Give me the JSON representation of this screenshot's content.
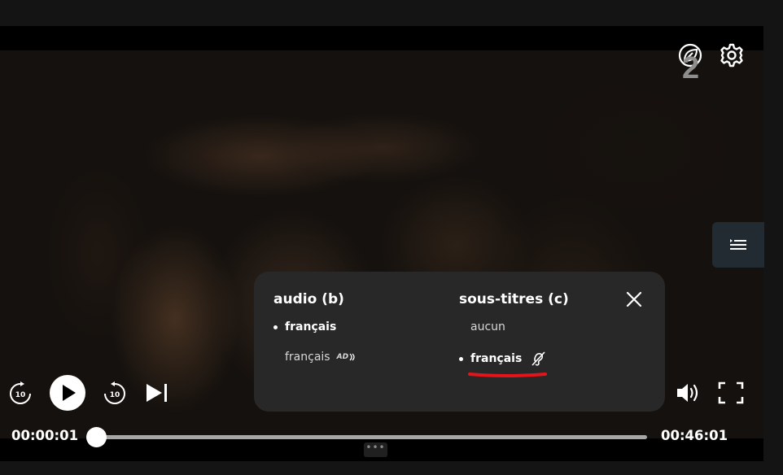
{
  "panel": {
    "audio": {
      "title": "audio (b)",
      "options": [
        {
          "label": "français",
          "selected": true
        },
        {
          "label": "français",
          "selected": false,
          "badge": "AD"
        }
      ]
    },
    "subtitles": {
      "title": "sous-titres (c)",
      "options": [
        {
          "label": "aucun",
          "selected": false
        },
        {
          "label": "français",
          "selected": true,
          "icon": "hearing-impaired-icon"
        }
      ]
    }
  },
  "player": {
    "current_time": "00:00:01",
    "total_time": "00:46:01",
    "progress": 0.0,
    "channel_logo": "2",
    "skip_seconds": "10"
  },
  "icons": [
    "eco-leaf-icon",
    "gear-icon",
    "chapters-list-icon",
    "close-icon",
    "replay-10-icon",
    "play-icon",
    "forward-10-icon",
    "skip-next-icon",
    "volume-icon",
    "fullscreen-icon",
    "more-dots-icon"
  ],
  "colors": {
    "accent_underline": "#e3141a",
    "panel_bg": "#282828",
    "chapters_bg": "#222a32"
  }
}
